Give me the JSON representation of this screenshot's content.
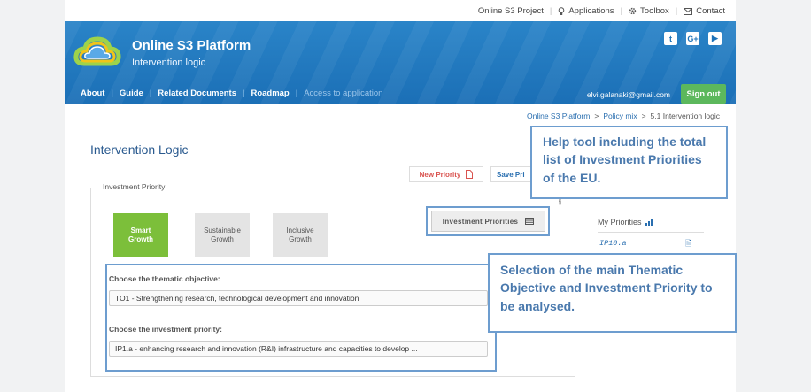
{
  "top_links": [
    {
      "label": "Online S3 Project",
      "icon": ""
    },
    {
      "label": "Applications",
      "icon": "lightbulb-icon"
    },
    {
      "label": "Toolbox",
      "icon": "gear-icon"
    },
    {
      "label": "Contact",
      "icon": "envelope-icon"
    }
  ],
  "header": {
    "title": "Online S3 Platform",
    "subtitle": "Intervention logic",
    "social": [
      "twitter-icon",
      "google-plus-icon",
      "youtube-icon"
    ],
    "email": "elvi.galanaki@gmail.com",
    "signout": "Sign out"
  },
  "nav": {
    "items": [
      "About",
      "Guide",
      "Related Documents",
      "Roadmap"
    ],
    "disabled": "Access to application"
  },
  "breadcrumb": [
    "Online S3 Platform",
    ">",
    "Policy mix",
    ">",
    "5.1 Intervention logic"
  ],
  "page_title": "Intervention Logic",
  "buttons": {
    "new_priority": "New Priority",
    "save": "Save Pri"
  },
  "fieldset_legend": "Investment Priority",
  "tiles": [
    {
      "line1": "Smart",
      "line2": "Growth"
    },
    {
      "line1": "Sustainable",
      "line2": "Growth"
    },
    {
      "line1": "Inclusive",
      "line2": "Growth"
    }
  ],
  "investment_priorities_button": "Investment Priorities",
  "thematic": {
    "label": "Choose the thematic objective:",
    "value": "TO1 - Strengthening research, technological development and innovation"
  },
  "investment": {
    "label": "Choose the investment priority:",
    "value": "IP1.a - enhancing research and innovation (R&I) infrastructure and capacities to develop ..."
  },
  "my_priorities": {
    "title": "My Priorities",
    "item": "IP10.a"
  },
  "callouts": {
    "help": "Help tool including the total list of Investment Priorities of the EU.",
    "selection": "Selection of the main Thematic Objective and Investment Priority to be analysed."
  },
  "colors": {
    "header_blue": "#1b6fb6",
    "smart_green": "#7cbf3a",
    "signout_green": "#5cb85c",
    "callout_border": "#6d9dcf"
  }
}
